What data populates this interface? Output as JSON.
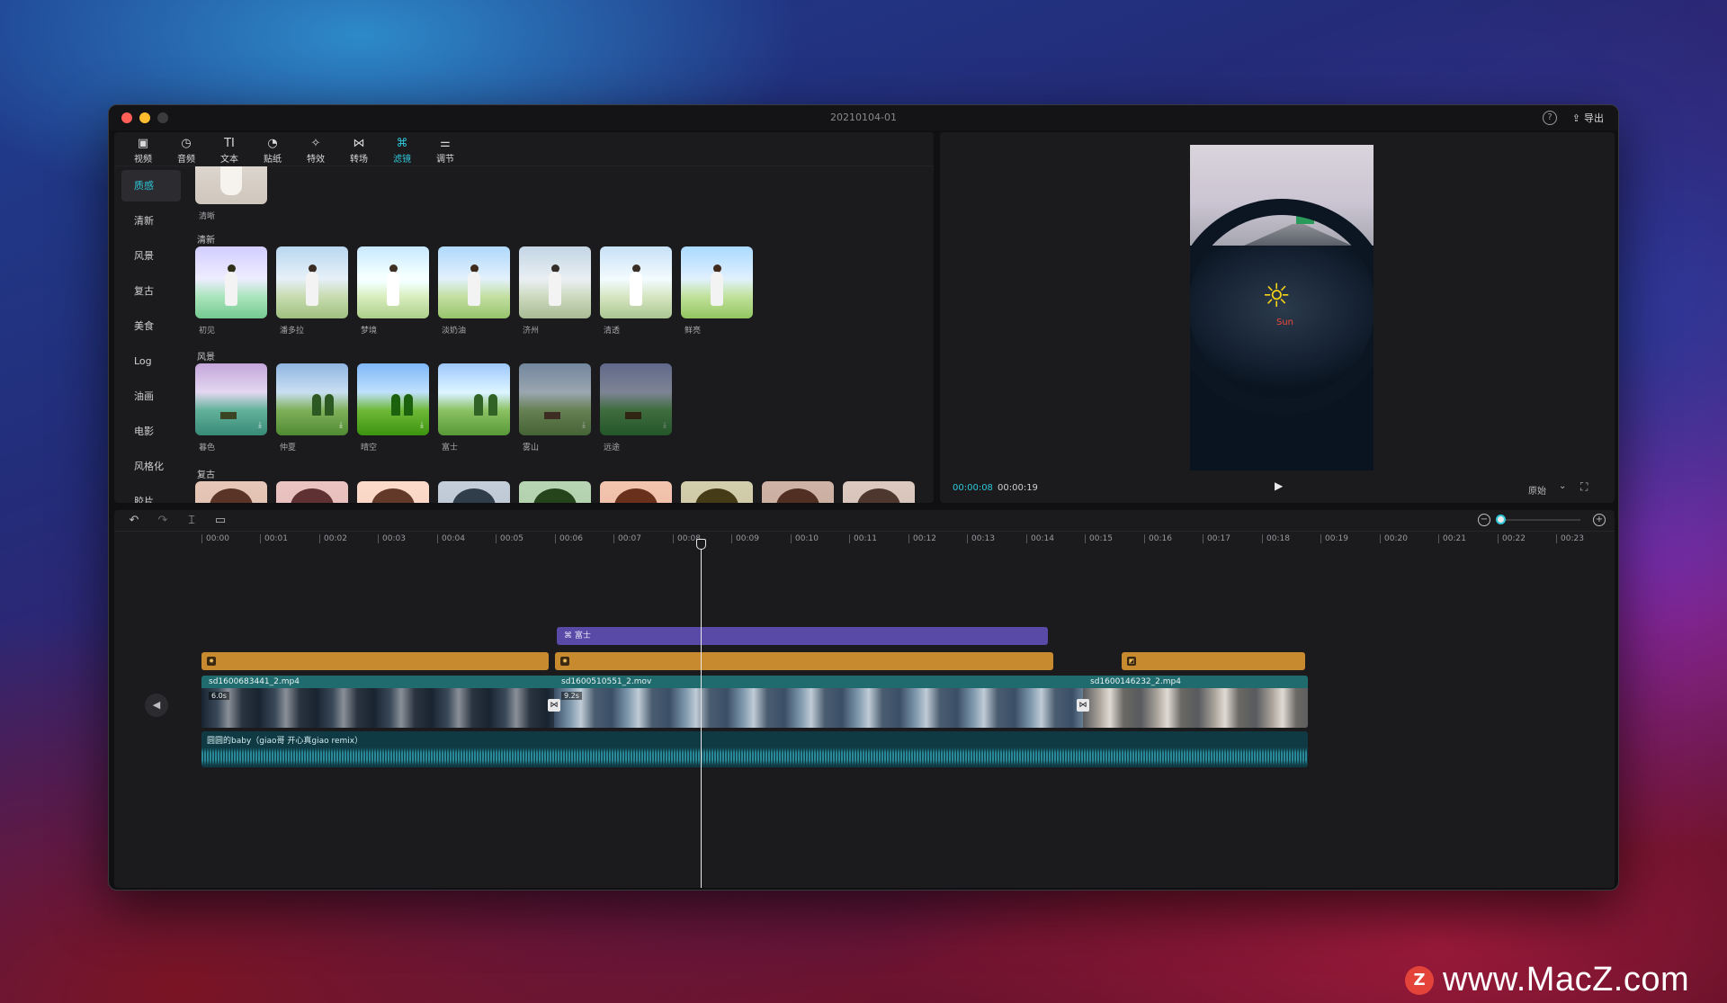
{
  "window": {
    "title": "20210104-01",
    "help_icon": "?",
    "export_label": "导出"
  },
  "toolbar_tabs": [
    {
      "label": "视频",
      "icon": "▣"
    },
    {
      "label": "音频",
      "icon": "◷"
    },
    {
      "label": "文本",
      "icon": "TI"
    },
    {
      "label": "贴纸",
      "icon": "◔"
    },
    {
      "label": "特效",
      "icon": "✧"
    },
    {
      "label": "转场",
      "icon": "⋈"
    },
    {
      "label": "滤镜",
      "icon": "⌘"
    },
    {
      "label": "调节",
      "icon": "⚌"
    }
  ],
  "active_tab": "滤镜",
  "categories": [
    "质感",
    "清新",
    "风景",
    "复古",
    "美食",
    "Log",
    "油画",
    "电影",
    "风格化",
    "胶片"
  ],
  "active_category": "质感",
  "sections": {
    "top_item": "清晰",
    "fresh": {
      "title": "清新",
      "items": [
        "初见",
        "潘多拉",
        "梦境",
        "淡奶油",
        "济州",
        "清透",
        "鲜亮"
      ]
    },
    "scenery": {
      "title": "风景",
      "items": [
        "暮色",
        "仲夏",
        "晴空",
        "富士",
        "雾山",
        "远途"
      ]
    },
    "retro": {
      "title": "复古"
    }
  },
  "preview": {
    "current_time": "00:00:08",
    "total_time": "00:00:19",
    "ratio_label": "原始",
    "sticker_text": "Sun"
  },
  "ruler": [
    "00:00",
    "00:01",
    "00:02",
    "00:03",
    "00:04",
    "00:05",
    "00:06",
    "00:07",
    "00:08",
    "00:09",
    "00:10",
    "00:11",
    "00:12",
    "00:13",
    "00:14",
    "00:15",
    "00:16",
    "00:17",
    "00:18",
    "00:19",
    "00:20",
    "00:21",
    "00:22",
    "00:23"
  ],
  "tracks": {
    "filter_clip": {
      "label": "富士"
    },
    "video_clips": [
      {
        "name": "sd1600683441_2.mp4",
        "duration": "6.0s"
      },
      {
        "name": "sd1600510551_2.mov",
        "duration": "9.2s"
      },
      {
        "name": "sd1600146232_2.mp4",
        "duration": ""
      }
    ],
    "audio": {
      "name": "圆圆的baby（giao哥 开心真giao remix）"
    }
  },
  "watermark": {
    "logo": "Z",
    "text": "www.MacZ.com"
  },
  "colors": {
    "accent": "#2fc6d6",
    "filter_clip": "#5a4aa8",
    "effect_clip": "#c88a2e",
    "video_track": "#1f6b6e"
  }
}
